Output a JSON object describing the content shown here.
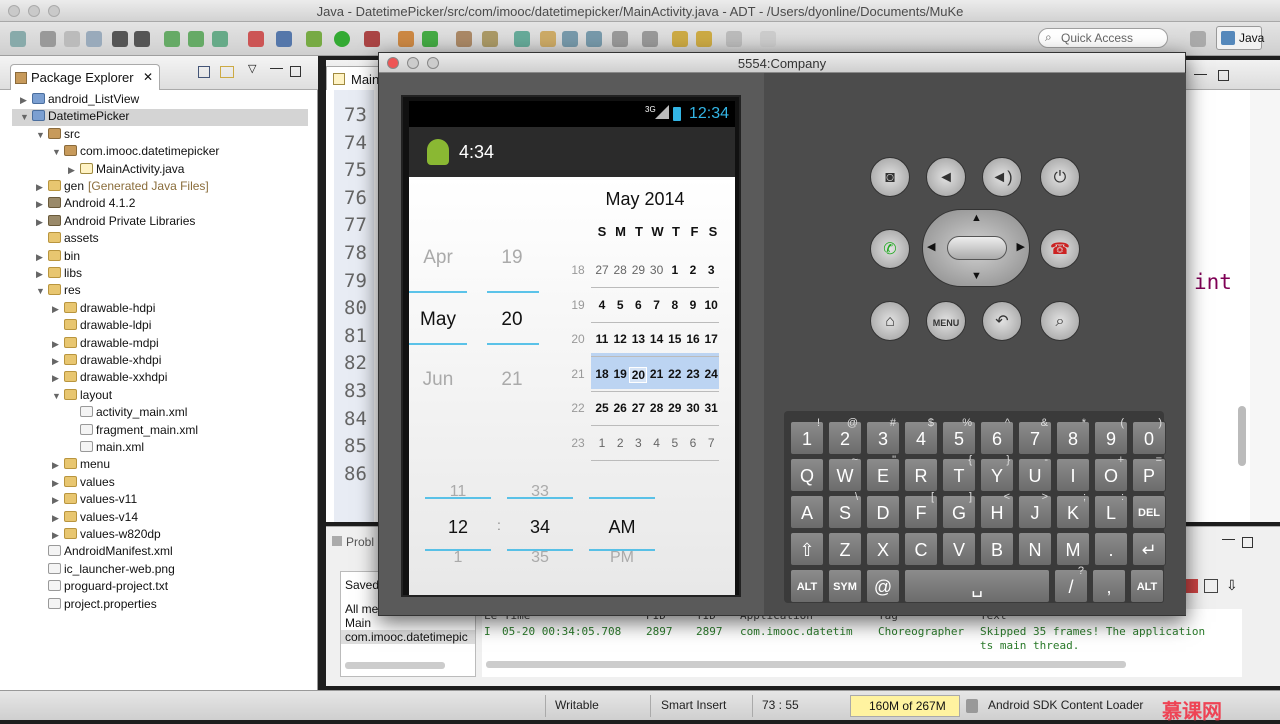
{
  "window": {
    "title": "Java - DatetimePicker/src/com/imooc/datetimepicker/MainActivity.java - ADT - /Users/dyonline/Documents/MuKe"
  },
  "toolbar": {
    "quick_access_placeholder": "Quick Access",
    "perspective_label": "Java"
  },
  "package_explorer": {
    "title": "Package Explorer",
    "items": [
      {
        "label": "android_ListView"
      },
      {
        "label": "DatetimePicker"
      },
      {
        "label": "src"
      },
      {
        "label": "com.imooc.datetimepicker"
      },
      {
        "label": "MainActivity.java"
      },
      {
        "label": "gen",
        "note": "[Generated Java Files]"
      },
      {
        "label": "Android 4.1.2"
      },
      {
        "label": "Android Private Libraries"
      },
      {
        "label": "assets"
      },
      {
        "label": "bin"
      },
      {
        "label": "libs"
      },
      {
        "label": "res"
      },
      {
        "label": "drawable-hdpi"
      },
      {
        "label": "drawable-ldpi"
      },
      {
        "label": "drawable-mdpi"
      },
      {
        "label": "drawable-xhdpi"
      },
      {
        "label": "drawable-xxhdpi"
      },
      {
        "label": "layout"
      },
      {
        "label": "activity_main.xml"
      },
      {
        "label": "fragment_main.xml"
      },
      {
        "label": "main.xml"
      },
      {
        "label": "menu"
      },
      {
        "label": "values"
      },
      {
        "label": "values-v11"
      },
      {
        "label": "values-v14"
      },
      {
        "label": "values-w820dp"
      },
      {
        "label": "AndroidManifest.xml"
      },
      {
        "label": "ic_launcher-web.png"
      },
      {
        "label": "proguard-project.txt"
      },
      {
        "label": "project.properties"
      }
    ]
  },
  "editor": {
    "tab_label": "Main",
    "line_numbers": [
      "73",
      "74",
      "75",
      "76",
      "77",
      "78",
      "79",
      "80",
      "81",
      "82",
      "83",
      "84",
      "85",
      "86"
    ],
    "code_fragment": "int"
  },
  "problems": {
    "tab_label": "Probl",
    "saved_label": "Saved",
    "filter_items": [
      "All me",
      "Main",
      "com.imooc.datetimepic"
    ],
    "log_header": [
      "Le Time",
      "PID",
      "TID",
      "Application",
      "Tag",
      "Text"
    ],
    "log_row": {
      "level": "I",
      "time": "05-20 00:34:05.708",
      "pid": "2897",
      "tid": "2897",
      "app": "com.imooc.datetim",
      "tag": "Choreographer",
      "text": "Skipped 35 frames!  The application",
      "text2": "ts main thread."
    }
  },
  "statusbar": {
    "writable": "Writable",
    "insert_mode": "Smart Insert",
    "position": "73 : 55",
    "memory": "160M of 267M",
    "task": "Android SDK Content Loader"
  },
  "emulator": {
    "title": "5554:Company",
    "clock": "12:34",
    "network": "3G",
    "actionbar_title": "4:34",
    "date_spinner": {
      "months": [
        "Apr",
        "May",
        "Jun"
      ],
      "days": [
        "19",
        "20",
        "21"
      ]
    },
    "calendar": {
      "month_title": "May 2014",
      "weekdays": [
        "S",
        "M",
        "T",
        "W",
        "T",
        "F",
        "S"
      ],
      "weeks": [
        {
          "num": "18",
          "days": [
            "27",
            "28",
            "29",
            "30",
            "1",
            "2",
            "3"
          ],
          "dim": [
            true,
            true,
            true,
            true,
            false,
            false,
            false
          ]
        },
        {
          "num": "19",
          "days": [
            "4",
            "5",
            "6",
            "7",
            "8",
            "9",
            "10"
          ],
          "dim": [
            false,
            false,
            false,
            false,
            false,
            false,
            false
          ]
        },
        {
          "num": "20",
          "days": [
            "11",
            "12",
            "13",
            "14",
            "15",
            "16",
            "17"
          ],
          "dim": [
            false,
            false,
            false,
            false,
            false,
            false,
            false
          ]
        },
        {
          "num": "21",
          "days": [
            "18",
            "19",
            "20",
            "21",
            "22",
            "23",
            "24"
          ],
          "dim": [
            false,
            false,
            false,
            false,
            false,
            false,
            false
          ]
        },
        {
          "num": "22",
          "days": [
            "25",
            "26",
            "27",
            "28",
            "29",
            "30",
            "31"
          ],
          "dim": [
            false,
            false,
            false,
            false,
            false,
            false,
            false
          ]
        },
        {
          "num": "23",
          "days": [
            "1",
            "2",
            "3",
            "4",
            "5",
            "6",
            "7"
          ],
          "dim": [
            true,
            true,
            true,
            true,
            true,
            true,
            true
          ]
        }
      ],
      "selected_week_index": 3,
      "selected_day": "20"
    },
    "time_spinner": {
      "hours": [
        "11",
        "12",
        "1"
      ],
      "minutes": [
        "33",
        "34",
        "35"
      ],
      "ampm": [
        "",
        "AM",
        "PM"
      ],
      "separator": ":"
    },
    "hw_buttons": [
      "camera",
      "volume-down",
      "volume-up",
      "power",
      "call",
      "end-call",
      "home",
      "MENU",
      "back",
      "search"
    ],
    "keyboard": {
      "row1": [
        {
          "k": "1",
          "s": "!"
        },
        {
          "k": "2",
          "s": "@"
        },
        {
          "k": "3",
          "s": "#"
        },
        {
          "k": "4",
          "s": "$"
        },
        {
          "k": "5",
          "s": "%"
        },
        {
          "k": "6",
          "s": "^"
        },
        {
          "k": "7",
          "s": "&"
        },
        {
          "k": "8",
          "s": "*"
        },
        {
          "k": "9",
          "s": "("
        },
        {
          "k": "0",
          "s": ")"
        }
      ],
      "row2": [
        {
          "k": "Q",
          "s": ""
        },
        {
          "k": "W",
          "s": "~"
        },
        {
          "k": "E",
          "s": "\""
        },
        {
          "k": "R",
          "s": ""
        },
        {
          "k": "T",
          "s": "{"
        },
        {
          "k": "Y",
          "s": "}"
        },
        {
          "k": "U",
          "s": "-"
        },
        {
          "k": "I",
          "s": ""
        },
        {
          "k": "O",
          "s": "+"
        },
        {
          "k": "P",
          "s": "="
        }
      ],
      "row3": [
        {
          "k": "A",
          "s": ""
        },
        {
          "k": "S",
          "s": "\\"
        },
        {
          "k": "D",
          "s": ""
        },
        {
          "k": "F",
          "s": "["
        },
        {
          "k": "G",
          "s": "]"
        },
        {
          "k": "H",
          "s": "<"
        },
        {
          "k": "J",
          "s": ">"
        },
        {
          "k": "K",
          "s": ";"
        },
        {
          "k": "L",
          "s": ":"
        },
        {
          "k": "DEL",
          "s": ""
        }
      ],
      "row4": [
        {
          "k": "⇧",
          "s": ""
        },
        {
          "k": "Z",
          "s": ""
        },
        {
          "k": "X",
          "s": ""
        },
        {
          "k": "C",
          "s": ""
        },
        {
          "k": "V",
          "s": ""
        },
        {
          "k": "B",
          "s": ""
        },
        {
          "k": "N",
          "s": ""
        },
        {
          "k": "M",
          "s": ""
        },
        {
          "k": ".",
          "s": ""
        },
        {
          "k": "↵",
          "s": ""
        }
      ],
      "row5": [
        {
          "k": "ALT",
          "s": ""
        },
        {
          "k": "SYM",
          "s": ""
        },
        {
          "k": "@",
          "s": ""
        },
        {
          "k": "␣",
          "s": ""
        },
        {
          "k": "/",
          "s": "?"
        },
        {
          "k": ",",
          "s": ""
        },
        {
          "k": "ALT",
          "s": ""
        }
      ]
    }
  }
}
